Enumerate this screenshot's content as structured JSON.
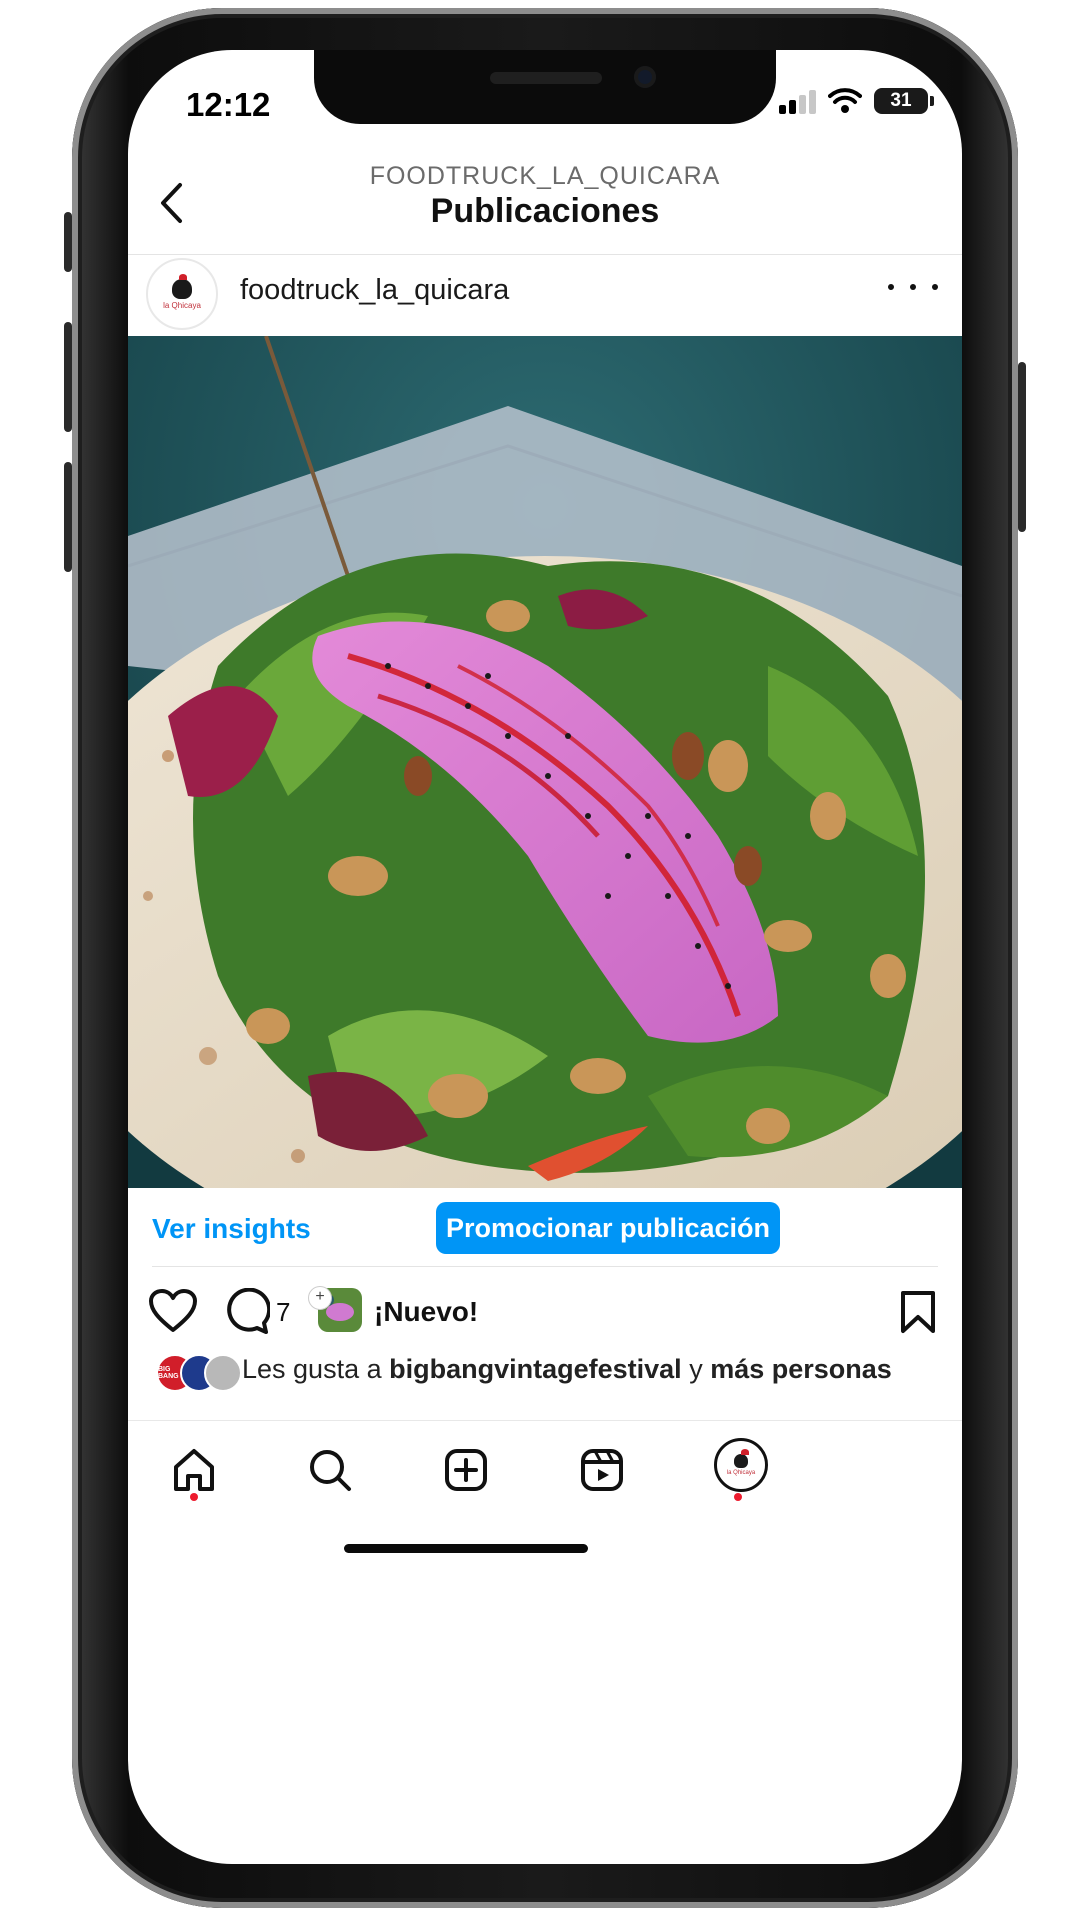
{
  "status_bar": {
    "time": "12:12",
    "battery": "31"
  },
  "header": {
    "username": "FOODTRUCK_LA_QUICARA",
    "title": "Publicaciones"
  },
  "post": {
    "username": "foodtruck_la_quicara",
    "avatar_text": "la Qhicaya"
  },
  "actions": {
    "insights_label": "Ver insights",
    "promote_label": "Promocionar publicación",
    "comment_count": "7",
    "new_label": "¡Nuevo!"
  },
  "likes": {
    "prefix": "Les gusta a",
    "user": "bigbangvintagefestival",
    "connector": "y",
    "more": "más personas",
    "liker_badge": "BIG BANG"
  },
  "nav": {
    "items": [
      "home-icon",
      "search-icon",
      "create-icon",
      "reels-icon",
      "profile-avatar"
    ]
  },
  "colors": {
    "accent": "#0095f6",
    "notification_dot": "#ed1b2e"
  }
}
